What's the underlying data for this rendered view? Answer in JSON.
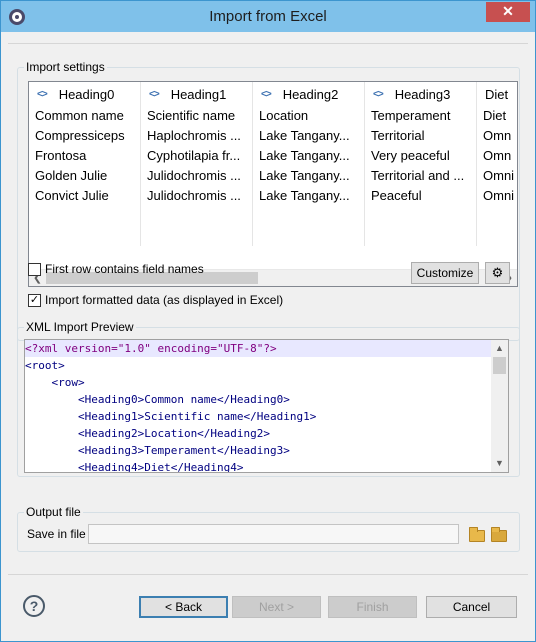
{
  "window": {
    "title": "Import from Excel",
    "close_glyph": "✕"
  },
  "import_settings": {
    "label": "Import settings",
    "columns": [
      "Heading0",
      "Heading1",
      "Heading2",
      "Heading3",
      "Diet"
    ],
    "rows": [
      [
        "Common name",
        "Scientific name",
        "Location",
        "Temperament",
        "Diet"
      ],
      [
        "Compressiceps",
        "Haplochromis ...",
        "Lake Tangany...",
        "Territorial",
        "Omn"
      ],
      [
        "Frontosa",
        "Cyphotilapia fr...",
        "Lake Tangany...",
        "Very peaceful",
        "Omn"
      ],
      [
        "Golden Julie",
        "Julidochromis ...",
        "Lake Tangany...",
        "Territorial and ...",
        "Omni"
      ],
      [
        "Convict Julie",
        "Julidochromis ...",
        "Lake Tangany...",
        "Peaceful",
        "Omni"
      ]
    ],
    "first_row_label": "First row contains field names",
    "first_row_checked": false,
    "formatted_label": "Import formatted data (as displayed in Excel)",
    "formatted_checked": true,
    "customize_label": "Customize"
  },
  "xml_preview": {
    "label": "XML Import Preview",
    "lines": [
      "<?xml version=\"1.0\" encoding=\"UTF-8\"?>",
      "<root>",
      "    <row>",
      "        <Heading0>Common name</Heading0>",
      "        <Heading1>Scientific name</Heading1>",
      "        <Heading2>Location</Heading2>",
      "        <Heading3>Temperament</Heading3>",
      "        <Heading4>Diet</Heading4>"
    ]
  },
  "output_file": {
    "label": "Output file",
    "save_label": "Save in file",
    "save_value": ""
  },
  "buttons": {
    "back": "< Back",
    "next": "Next >",
    "finish": "Finish",
    "cancel": "Cancel"
  },
  "colors": {
    "titlebar": "#7fc1ea",
    "close": "#c75050",
    "accent": "#3c7fb1"
  }
}
